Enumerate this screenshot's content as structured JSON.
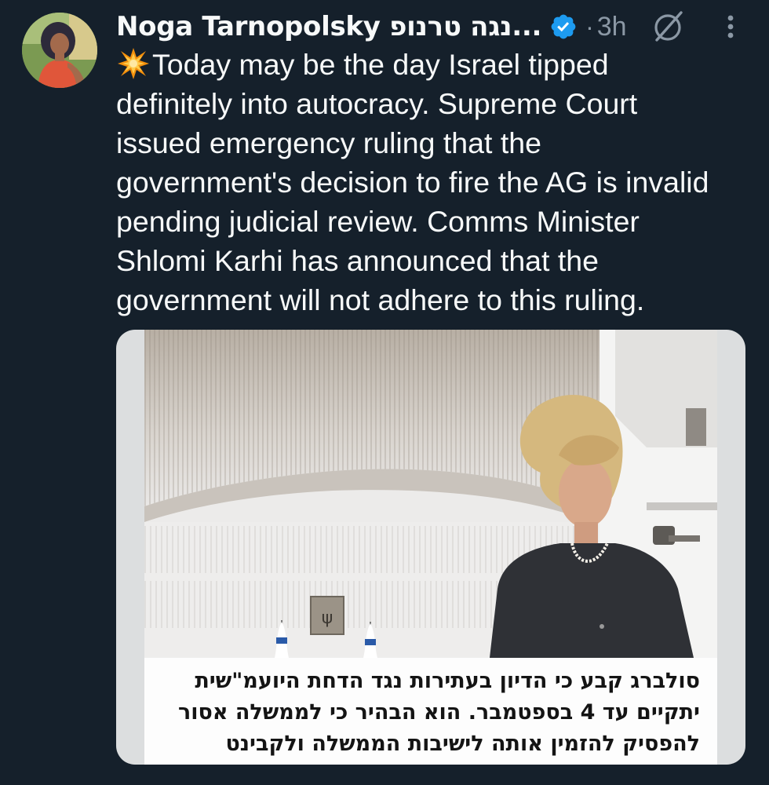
{
  "post": {
    "author": {
      "display_name": "Noga Tarnopolsky נגה טרנופ...",
      "verified": true,
      "avatar_icon": "profile-photo"
    },
    "separator": "·",
    "time": "3h",
    "actions": {
      "grok_icon": "grok-slash-icon",
      "more_icon": "vertical-ellipsis-icon"
    },
    "emoji": "collision-emoji",
    "text_lines": [
      "Today may be the day Israel tipped",
      "definitely into autocracy. Supreme Court",
      "issued emergency ruling that the",
      "government's decision to fire the AG is invalid",
      "pending judicial review. Comms Minister",
      "Shlomi Karhi has announced that the",
      "government will not adhere to this ruling."
    ],
    "media": {
      "type": "image",
      "caption_lines": [
        "סולברג קבע כי הדיון בעתירות נגד הדחת היועמ\"שית",
        "יתקיים עד 4 בספטמבר. הוא הבהיר כי לממשלה אסור",
        "להפסיק להזמין אותה לישיבות הממשלה ולקבינט"
      ]
    }
  },
  "colors": {
    "background": "#15202b",
    "text_primary": "#f7f9f9",
    "text_secondary": "#8b98a5",
    "verified_blue": "#1d9bf0"
  }
}
